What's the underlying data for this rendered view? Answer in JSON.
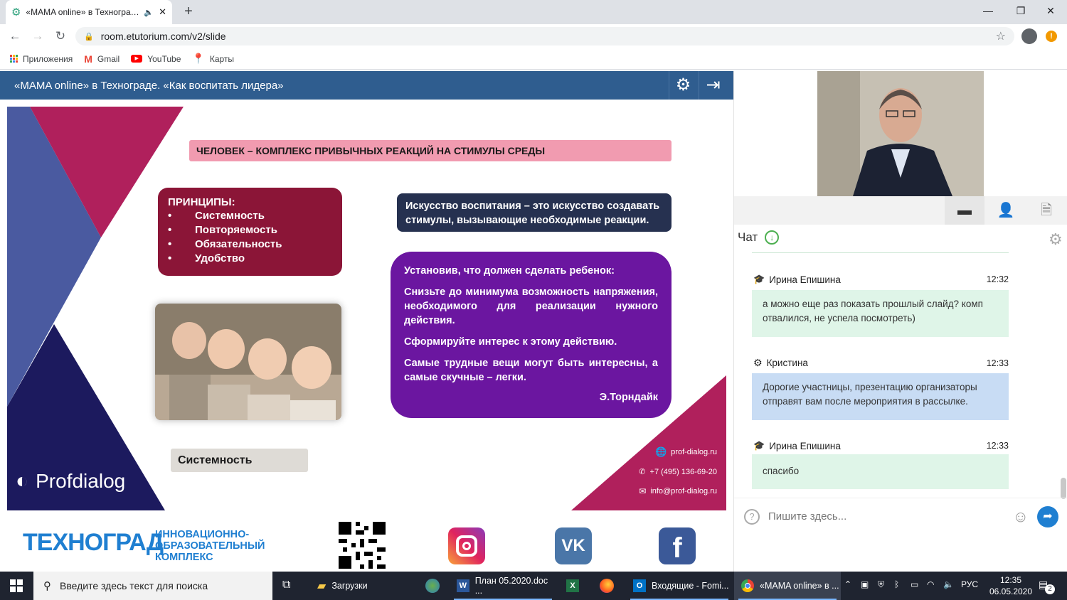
{
  "browser": {
    "tab_title": "«MAMA online» в Техногра…",
    "new_tab": "+",
    "minimize": "—",
    "maximize": "❐",
    "close": "✕",
    "url": "room.etutorium.com/v2/slide",
    "bookmarks": [
      {
        "label": "Приложения",
        "icon": "apps-grid-icon"
      },
      {
        "label": "Gmail",
        "icon": "gmail-icon"
      },
      {
        "label": "YouTube",
        "icon": "youtube-icon"
      },
      {
        "label": "Карты",
        "icon": "maps-icon"
      }
    ]
  },
  "app": {
    "title": "«MAMA online» в Технограде. «Как воспитать лидера»"
  },
  "slide": {
    "heading": "ЧЕЛОВЕК – КОМПЛЕКС ПРИВЫЧНЫХ РЕАКЦИЙ НА СТИМУЛЫ СРЕДЫ",
    "principles_title": "ПРИНЦИПЫ:",
    "principles": [
      "Системность",
      "Повторяемость",
      "Обязательность",
      "Удобство"
    ],
    "art_text": "Искусство воспитания – это искусство создавать стимулы, вызывающие необходимые реакции.",
    "purple_title": "Установив, что должен сделать ребенок:",
    "purple_p1": "Снизьте до минимума возможность напряжения, необходимого для реализации нужного действия.",
    "purple_p2": "Сформируйте интерес к этому действию.",
    "purple_p3": "Самые трудные вещи могут быть интересны, а самые скучные – легки.",
    "purple_author": "Э.Торндайк",
    "system_label": "Системность",
    "logo": "Profdialog",
    "site": "prof-dialog.ru",
    "phone": "+7 (495) 136-69-20",
    "email": "info@prof-dialog.ru",
    "colors": {
      "pink": "#f19bb0",
      "maroon": "#8b1537",
      "purple": "#6b16a0",
      "navy": "#263150",
      "magenta": "#b0205c",
      "blue": "#4a5aa0"
    }
  },
  "bottom": {
    "techno": "ТЕХНОГРАД",
    "techno_sub": [
      "ИННОВАЦИОННО-",
      "ОБРАЗОВАТЕЛЬНЫЙ",
      "КОМПЛЕКС"
    ]
  },
  "chat": {
    "title": "Чат",
    "messages": [
      {
        "author": "Ирина Епишина",
        "time": "12:32",
        "text": "а можно еще раз показать прошлый слайд? комп отвалился, не успела посмотреть)",
        "role": "student"
      },
      {
        "author": "Кристина",
        "time": "12:33",
        "text": "Дорогие участницы, презентацию организаторы отправят вам после мероприятия в рассылке.",
        "role": "moderator"
      },
      {
        "author": "Ирина Епишина",
        "time": "12:33",
        "text": "спасибо",
        "role": "student"
      }
    ],
    "input_placeholder": "Пишите здесь..."
  },
  "taskbar": {
    "search_placeholder": "Введите здесь текст для поиска",
    "items": [
      {
        "label": "Загрузки"
      },
      {
        "label": "План 05.2020.doc ..."
      },
      {
        "label": "Входящие - Fomi..."
      },
      {
        "label": "«MAMA online» в ..."
      }
    ],
    "lang": "РУС",
    "time": "12:35",
    "date": "06.05.2020",
    "notifications": "2"
  }
}
